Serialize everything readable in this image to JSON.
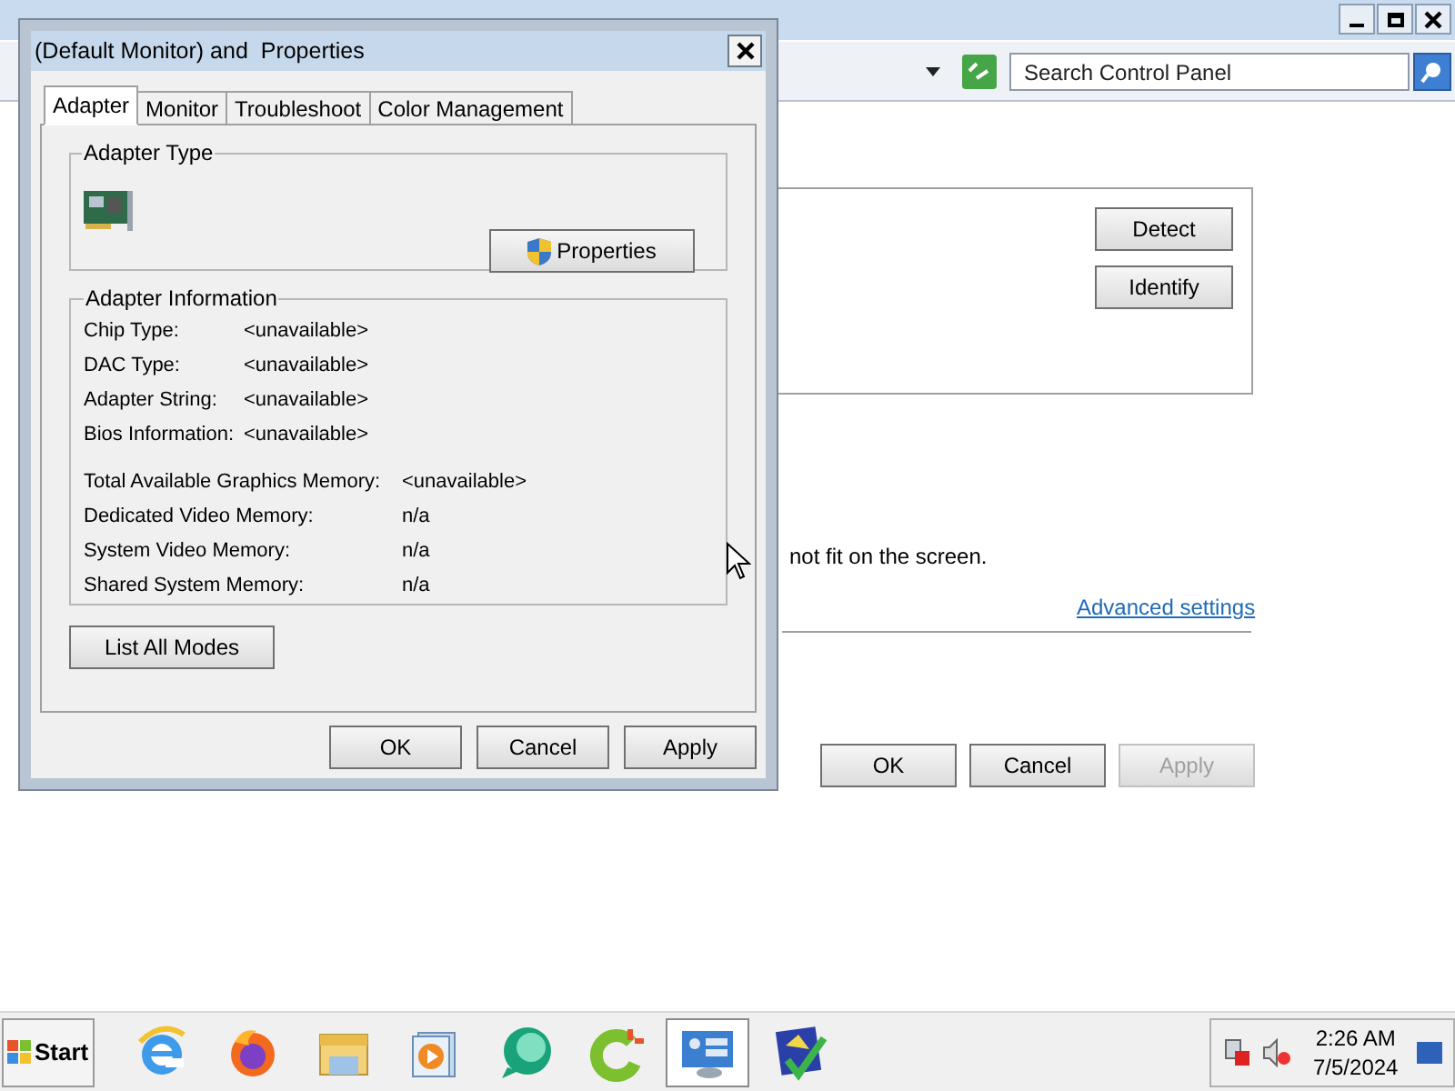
{
  "background_window": {
    "search": {
      "placeholder": "Search Control Panel"
    },
    "buttons": [
      {
        "label": "Detect"
      },
      {
        "label": "Identify"
      }
    ],
    "note": "not fit on the screen.",
    "link": "Advanced settings",
    "footer_buttons": [
      {
        "label": "OK",
        "disabled": false
      },
      {
        "label": "Cancel",
        "disabled": false
      },
      {
        "label": "Apply",
        "disabled": true
      }
    ]
  },
  "dialog": {
    "title": "(Default Monitor) and  Properties",
    "tabs": [
      {
        "label": "Adapter",
        "selected": true
      },
      {
        "label": "Monitor",
        "selected": false
      },
      {
        "label": "Troubleshoot",
        "selected": false
      },
      {
        "label": "Color Management",
        "selected": false
      }
    ],
    "adapter_type": {
      "heading": "Adapter Type",
      "button": "Properties"
    },
    "adapter_information": {
      "heading": "Adapter Information",
      "rows": [
        {
          "label": "Chip Type:",
          "value": "<unavailable>"
        },
        {
          "label": "DAC Type:",
          "value": "<unavailable>"
        },
        {
          "label": "Adapter String:",
          "value": "<unavailable>"
        },
        {
          "label": "Bios Information:",
          "value": "<unavailable>"
        }
      ],
      "memory_rows": [
        {
          "label": "Total Available Graphics Memory:",
          "value": "<unavailable>"
        },
        {
          "label": "Dedicated Video Memory:",
          "value": "n/a"
        },
        {
          "label": "System Video Memory:",
          "value": "n/a"
        },
        {
          "label": "Shared System Memory:",
          "value": "n/a"
        }
      ]
    },
    "list_button": "List All Modes",
    "buttons": [
      {
        "label": "OK",
        "disabled": false
      },
      {
        "label": "Cancel",
        "disabled": false
      },
      {
        "label": "Apply",
        "disabled": false
      }
    ]
  },
  "taskbar": {
    "start": "Start",
    "apps": [
      {
        "kind": "ie",
        "selected": false
      },
      {
        "kind": "firefox",
        "selected": false
      },
      {
        "kind": "folder",
        "selected": false
      },
      {
        "kind": "media",
        "selected": false
      },
      {
        "kind": "chat",
        "selected": false
      },
      {
        "kind": "cleaner",
        "selected": false
      },
      {
        "kind": "panel",
        "selected": true
      },
      {
        "kind": "certificate",
        "selected": false
      }
    ],
    "time": "2:26 AM",
    "date": "7/5/2024"
  }
}
